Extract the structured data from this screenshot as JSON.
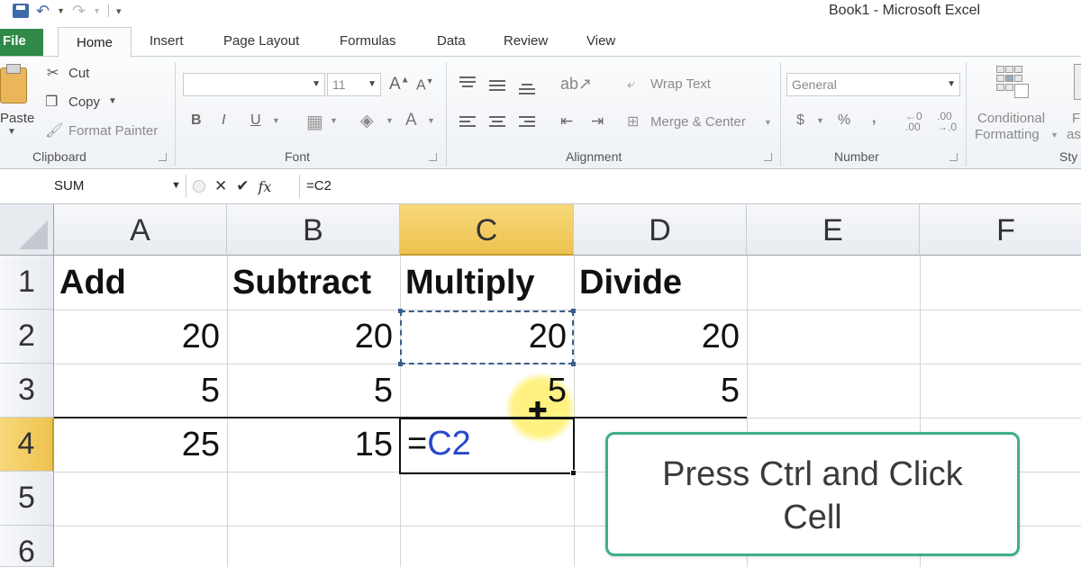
{
  "window": {
    "title": "Book1  -  Microsoft Excel"
  },
  "tabs": {
    "file": "File",
    "items": [
      "Home",
      "Insert",
      "Page Layout",
      "Formulas",
      "Data",
      "Review",
      "View"
    ]
  },
  "clipboard": {
    "paste": "Paste",
    "cut": "Cut",
    "copy": "Copy",
    "format_painter": "Format Painter",
    "group": "Clipboard"
  },
  "font": {
    "name": "",
    "size": "11",
    "bold": "B",
    "italic": "I",
    "underline": "U",
    "group": "Font"
  },
  "alignment": {
    "wrap_text": "Wrap Text",
    "merge_center": "Merge & Center",
    "group": "Alignment"
  },
  "number": {
    "format": "General",
    "currency": "$",
    "percent": "%",
    "comma": ",",
    "group": "Number"
  },
  "styles": {
    "conditional_1": "Conditional",
    "conditional_2": "Formatting",
    "format_as_1": "F",
    "format_as_2": "as",
    "group": "Sty"
  },
  "formula_bar": {
    "name_box": "SUM",
    "fx": "fx",
    "formula": "=C2"
  },
  "sheet": {
    "columns": [
      "A",
      "B",
      "C",
      "D",
      "E",
      "F"
    ],
    "rows": [
      "1",
      "2",
      "3",
      "4",
      "5",
      "6"
    ],
    "selected_column": "C",
    "selected_row": "4",
    "headers": [
      "Add",
      "Subtract",
      "Multiply",
      "Divide"
    ],
    "row2": [
      "20",
      "20",
      "20",
      "20"
    ],
    "row3": [
      "5",
      "5",
      "5",
      "5"
    ],
    "row4": [
      "25",
      "15"
    ],
    "editing": {
      "prefix": "=",
      "ref": "C2"
    }
  },
  "callout": {
    "line1": "Press Ctrl and Click",
    "line2": "Cell"
  },
  "colors": {
    "file_tab": "#2f8a47",
    "selection": "#eec24f",
    "callout_border": "#3fae8b",
    "cell_ref": "#2848c8"
  }
}
